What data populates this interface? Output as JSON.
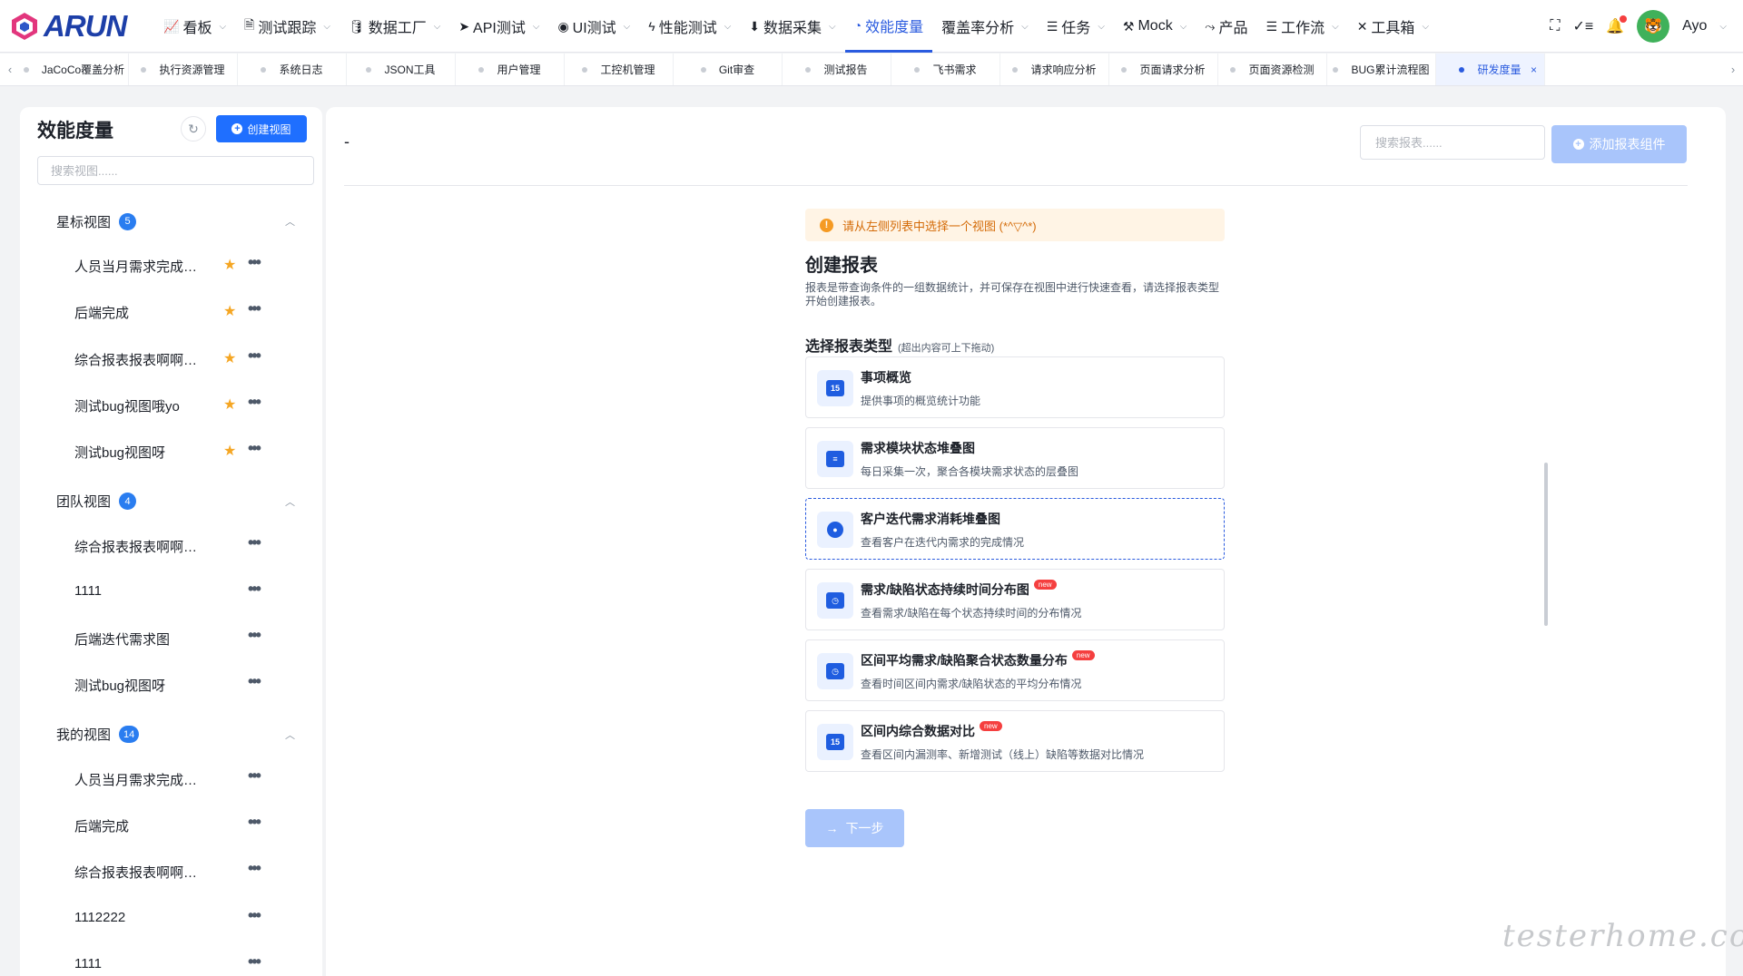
{
  "app": {
    "logo": "ARUN"
  },
  "nav": {
    "items": [
      {
        "icon": "📈",
        "label": "看板",
        "chev": "⌵"
      },
      {
        "icon": "🗎",
        "label": "测试跟踪",
        "chev": "⌵"
      },
      {
        "icon": "🛢",
        "label": "数据工厂",
        "chev": "⌵"
      },
      {
        "icon": "➤",
        "label": "API测试",
        "chev": "⌵"
      },
      {
        "icon": "◉",
        "label": "UI测试",
        "chev": "⌵"
      },
      {
        "icon": "ϟ",
        "label": "性能测试",
        "chev": "⌵"
      },
      {
        "icon": "⬇",
        "label": "数据采集",
        "chev": "⌵"
      },
      {
        "icon": "◔",
        "label": "效能度量",
        "chev": ""
      },
      {
        "icon": "",
        "label": "覆盖率分析",
        "chev": "⌵"
      },
      {
        "icon": "☰",
        "label": "任务",
        "chev": "⌵"
      },
      {
        "icon": "⚒",
        "label": "Mock",
        "chev": "⌵"
      },
      {
        "icon": "⤳",
        "label": "产品",
        "chev": ""
      },
      {
        "icon": "☰",
        "label": "工作流",
        "chev": "⌵"
      },
      {
        "icon": "✕",
        "label": "工具箱",
        "chev": "⌵"
      }
    ],
    "active_index": 7
  },
  "user": {
    "name": "Ayo",
    "avatar_glyph": "🐯"
  },
  "tabs": {
    "items": [
      "JaCoCo覆盖分析",
      "执行资源管理",
      "系统日志",
      "JSON工具",
      "用户管理",
      "工控机管理",
      "Git审查",
      "测试报告",
      "飞书需求",
      "请求响应分析",
      "页面请求分析",
      "页面资源检测",
      "BUG累计流程图",
      "研发度量"
    ],
    "active_index": 13,
    "close_glyph": "×",
    "left_arrow": "‹",
    "right_arrow": "›"
  },
  "sidebar": {
    "title": "效能度量",
    "refresh_glyph": "↻",
    "create_label": "创建视图",
    "search_placeholder": "搜索视图......",
    "groups": [
      {
        "label": "星标视图",
        "count": "5",
        "items": [
          {
            "label": "人员当月需求完成情况",
            "star": true
          },
          {
            "label": "后端完成",
            "star": true
          },
          {
            "label": "综合报表报表啊啊啊啊",
            "star": true
          },
          {
            "label": "测试bug视图哦yo",
            "star": true
          },
          {
            "label": "测试bug视图呀",
            "star": true
          }
        ]
      },
      {
        "label": "团队视图",
        "count": "4",
        "items": [
          {
            "label": "综合报表报表啊啊啊啊",
            "star": false
          },
          {
            "label": "1111",
            "star": false
          },
          {
            "label": "后端迭代需求图",
            "star": false
          },
          {
            "label": "测试bug视图呀",
            "star": false
          }
        ]
      },
      {
        "label": "我的视图",
        "count": "14",
        "items": [
          {
            "label": "人员当月需求完成情况",
            "star": false
          },
          {
            "label": "后端完成",
            "star": false
          },
          {
            "label": "综合报表报表啊啊啊啊",
            "star": false
          },
          {
            "label": "1112222",
            "star": false
          },
          {
            "label": "1111",
            "star": false
          }
        ]
      }
    ]
  },
  "main": {
    "view_name": "-",
    "search_placeholder": "搜索报表......",
    "add_label": "添加报表组件",
    "alert": "请从左侧列表中选择一个视图 (*^▽^*)",
    "create_title": "创建报表",
    "create_desc": "报表是带查询条件的一组数据统计，并可保存在视图中进行快速查看，请选择报表类型开始创建报表。",
    "select_title": "选择报表类型",
    "select_hint": "(超出内容可上下拖动)",
    "report_types": [
      {
        "title": "事项概览",
        "desc": "提供事项的概览统计功能",
        "icon": "15",
        "new": false,
        "selected": false
      },
      {
        "title": "需求模块状态堆叠图",
        "desc": "每日采集一次，聚合各模块需求状态的层叠图",
        "icon": "≡",
        "new": false,
        "selected": false
      },
      {
        "title": "客户迭代需求消耗堆叠图",
        "desc": "查看客户在迭代内需求的完成情况",
        "icon": "●",
        "new": false,
        "selected": true
      },
      {
        "title": "需求/缺陷状态持续时间分布图",
        "desc": "查看需求/缺陷在每个状态持续时间的分布情况",
        "icon": "◷",
        "new": true,
        "selected": false
      },
      {
        "title": "区间平均需求/缺陷聚合状态数量分布",
        "desc": "查看时间区间内需求/缺陷状态的平均分布情况",
        "icon": "◷",
        "new": true,
        "selected": false
      },
      {
        "title": "区间内综合数据对比",
        "desc": "查看区间内漏测率、新增测试（线上）缺陷等数据对比情况",
        "icon": "15",
        "new": true,
        "selected": false
      }
    ],
    "new_badge": "new",
    "next_label": "下一步"
  },
  "watermark": "testerhome.com",
  "colors": {
    "primary": "#1f6fff",
    "active": "#2a5bdf",
    "star": "#f5a623",
    "alert_bg": "#fff4e5",
    "alert_text": "#d46b08"
  }
}
